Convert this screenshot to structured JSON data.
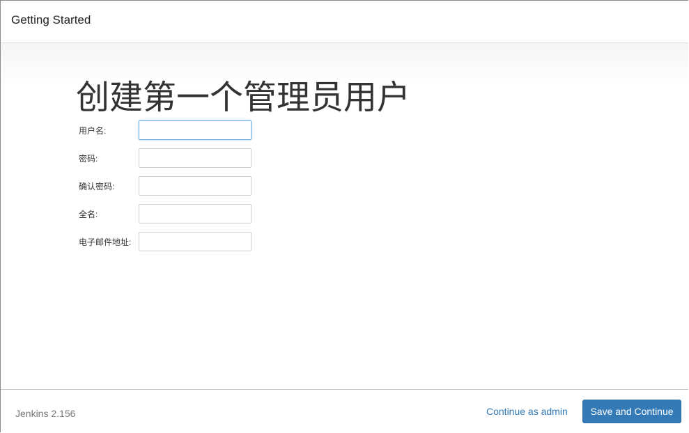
{
  "header": {
    "title": "Getting Started"
  },
  "main": {
    "title": "创建第一个管理员用户",
    "fields": [
      {
        "label": "用户名:",
        "value": ""
      },
      {
        "label": "密码:",
        "value": ""
      },
      {
        "label": "确认密码:",
        "value": ""
      },
      {
        "label": "全名:",
        "value": ""
      },
      {
        "label": "电子邮件地址:",
        "value": ""
      }
    ]
  },
  "footer": {
    "version": "Jenkins 2.156",
    "continue_link": "Continue as admin",
    "save_button": "Save and Continue",
    "accent": "#337ab7"
  }
}
